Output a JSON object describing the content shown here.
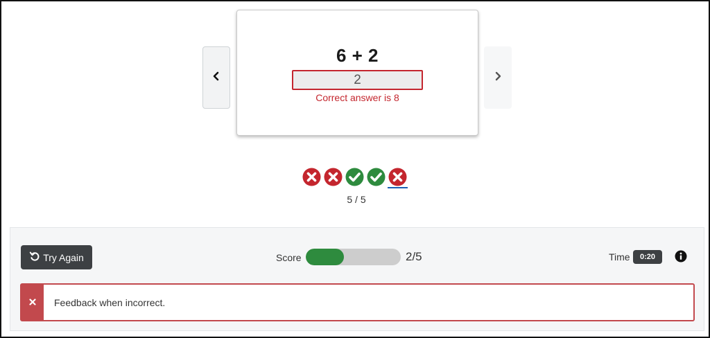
{
  "card": {
    "question": "6 + 2",
    "user_answer": "2",
    "correct_answer_text": "Correct answer is 8"
  },
  "icons": {
    "prev": "chevron-left-icon",
    "next": "chevron-right-icon",
    "retry": "undo-icon",
    "info": "info-icon",
    "feedback": "close-icon"
  },
  "progress": {
    "results": [
      "incorrect",
      "incorrect",
      "correct",
      "correct",
      "incorrect"
    ],
    "current_index": 4,
    "counter": "5 / 5"
  },
  "footer": {
    "try_again_label": "Try Again",
    "score_label": "Score",
    "score_value": "2/5",
    "score_fraction": 0.4,
    "time_label": "Time",
    "time_value": "0:20",
    "feedback_text": "Feedback when incorrect."
  },
  "colors": {
    "incorrect": "#c4262e",
    "correct": "#2e8b3e",
    "dark": "#3d4043",
    "feedback": "#c2494d"
  }
}
